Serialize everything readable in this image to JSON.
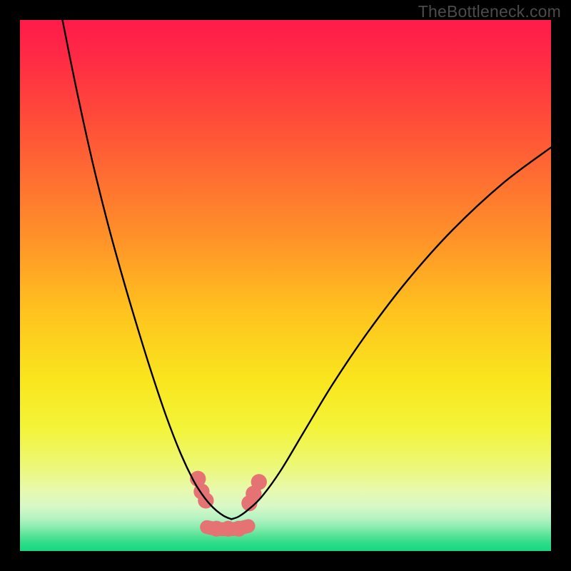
{
  "watermark": "TheBottleneck.com",
  "chart_data": {
    "type": "line",
    "title": "",
    "xlabel": "",
    "ylabel": "",
    "xlim": [
      0,
      1
    ],
    "ylim": [
      0,
      1
    ],
    "background_gradient_stops": [
      {
        "offset": 0.0,
        "color": "#ff1b4a"
      },
      {
        "offset": 0.07,
        "color": "#ff2a45"
      },
      {
        "offset": 0.18,
        "color": "#ff4a3a"
      },
      {
        "offset": 0.3,
        "color": "#ff6f31"
      },
      {
        "offset": 0.42,
        "color": "#ff9528"
      },
      {
        "offset": 0.55,
        "color": "#ffc31e"
      },
      {
        "offset": 0.68,
        "color": "#f9e61e"
      },
      {
        "offset": 0.77,
        "color": "#f3f43a"
      },
      {
        "offset": 0.84,
        "color": "#ecf876"
      },
      {
        "offset": 0.885,
        "color": "#e7f9ad"
      },
      {
        "offset": 0.915,
        "color": "#d8f8c6"
      },
      {
        "offset": 0.938,
        "color": "#b6f3c2"
      },
      {
        "offset": 0.955,
        "color": "#8aecae"
      },
      {
        "offset": 0.97,
        "color": "#5be39a"
      },
      {
        "offset": 0.985,
        "color": "#2fdc89"
      },
      {
        "offset": 1.0,
        "color": "#15d97f"
      }
    ],
    "series": [
      {
        "name": "left-branch",
        "stroke": "#000000",
        "stroke_width": 2.4,
        "x": [
          0.08,
          0.098,
          0.118,
          0.14,
          0.165,
          0.192,
          0.22,
          0.248,
          0.276,
          0.302,
          0.326,
          0.342,
          0.356,
          0.37,
          0.384,
          0.398
        ],
        "y": [
          1.0,
          0.91,
          0.815,
          0.718,
          0.618,
          0.52,
          0.425,
          0.335,
          0.252,
          0.185,
          0.134,
          0.108,
          0.09,
          0.076,
          0.066,
          0.06
        ]
      },
      {
        "name": "right-branch",
        "stroke": "#000000",
        "stroke_width": 2.4,
        "x": [
          0.398,
          0.412,
          0.43,
          0.455,
          0.49,
          0.535,
          0.59,
          0.655,
          0.73,
          0.815,
          0.91,
          1.0
        ],
        "y": [
          0.06,
          0.065,
          0.078,
          0.102,
          0.15,
          0.225,
          0.316,
          0.412,
          0.51,
          0.605,
          0.693,
          0.76
        ]
      }
    ],
    "markers": {
      "name": "trough-dots",
      "fill": "#e57373",
      "radius_rel": 0.015,
      "x": [
        0.335,
        0.342,
        0.35,
        0.37,
        0.392,
        0.412,
        0.432,
        0.44,
        0.45
      ],
      "y": [
        0.136,
        0.112,
        0.095,
        0.042,
        0.042,
        0.042,
        0.09,
        0.108,
        0.13
      ]
    },
    "trough_band": {
      "name": "trough-band",
      "stroke": "#e57373",
      "stroke_width_rel": 0.026,
      "x": [
        0.352,
        0.368,
        0.388,
        0.408,
        0.43
      ],
      "y": [
        0.045,
        0.042,
        0.041,
        0.042,
        0.047
      ]
    }
  }
}
